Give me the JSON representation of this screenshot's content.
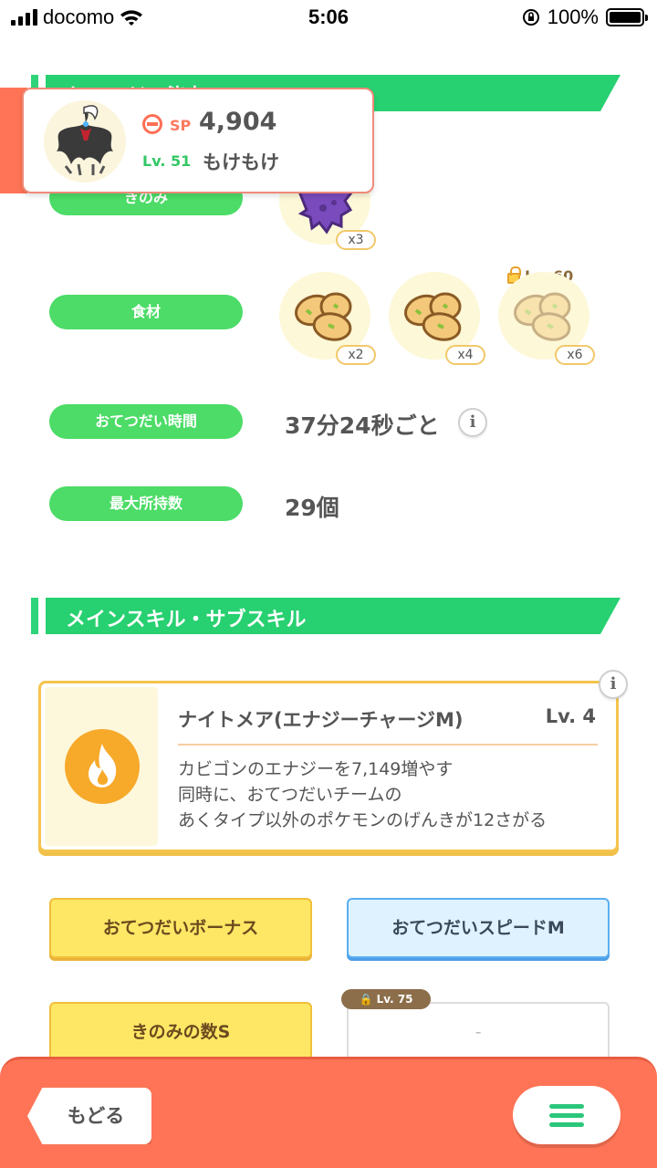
{
  "status_bar": {
    "carrier": "docomo",
    "time": "5:06",
    "battery": "100%",
    "battery_level": 1.0
  },
  "help_section": {
    "header": "おてつだい能力",
    "berry": {
      "label": "きのみ",
      "quantity": "x3"
    },
    "ingredients": {
      "label": "食材",
      "items": [
        {
          "quantity": "x2",
          "locked": false
        },
        {
          "quantity": "x4",
          "locked": false
        },
        {
          "quantity": "x6",
          "locked": true,
          "unlock_level": "Lv. 60"
        }
      ]
    },
    "help_time": {
      "label": "おてつだい時間",
      "value": "37分24秒ごと"
    },
    "max_carry": {
      "label": "最大所持数",
      "value": "29個"
    }
  },
  "pokemon_card": {
    "sp_label": "SP",
    "sp_value": "4,904",
    "level": "Lv. 51",
    "nickname": "もけもけ"
  },
  "skill_section": {
    "header": "メインスキル・サブスキル",
    "main_skill": {
      "name": "ナイトメア(エナジーチャージM)",
      "level": "Lv. 4",
      "description": [
        "カビゴンのエナジーを7,149増やす",
        "同時に、おてつだいチームの",
        "あくタイプ以外のポケモンのげんきが12さがる"
      ]
    },
    "sub_skills": [
      {
        "label": "おてつだいボーナス",
        "style": "gold"
      },
      {
        "label": "おてつだいスピードM",
        "style": "blue"
      },
      {
        "label": "きのみの数S",
        "style": "gold"
      },
      {
        "label": "-",
        "style": "empty",
        "unlock_level": "Lv. 75"
      }
    ]
  },
  "bottom_bar": {
    "back_label": "もどる"
  },
  "colors": {
    "accent_green": "#27d070",
    "pill_green": "#4cdc67",
    "bottom_orange": "#ff7456",
    "gold": "#ffe766",
    "blue": "#dff2ff"
  }
}
